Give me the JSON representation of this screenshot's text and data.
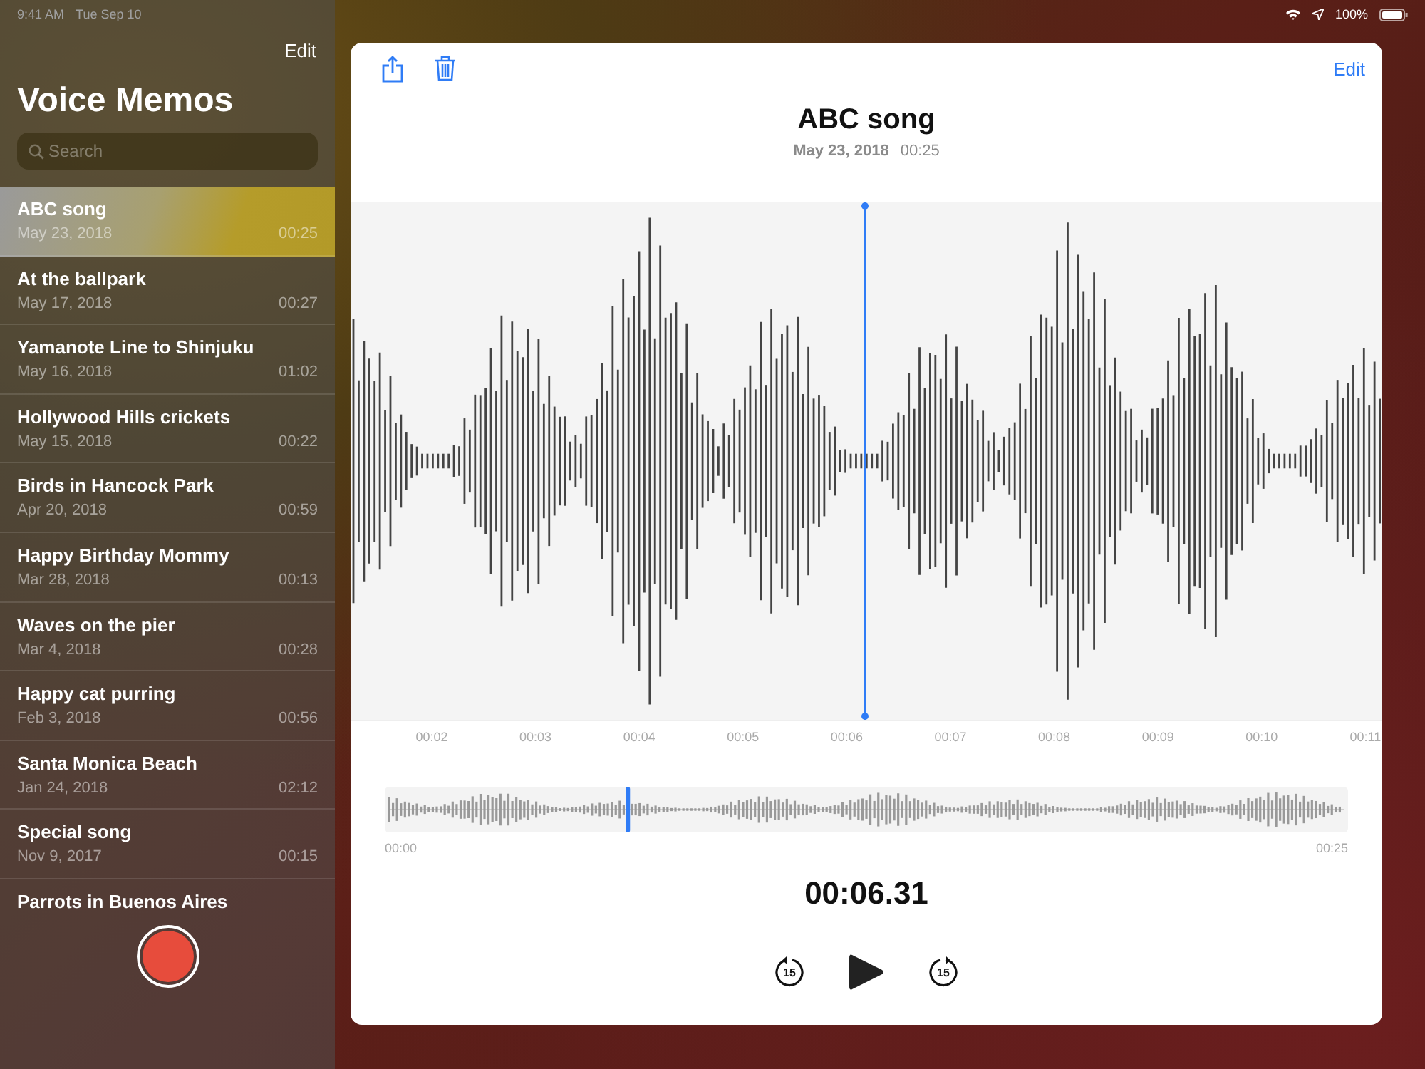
{
  "status_bar": {
    "time": "9:41 AM",
    "date": "Tue Sep 10",
    "battery": "100%"
  },
  "sidebar": {
    "edit": "Edit",
    "title": "Voice Memos",
    "search": {
      "placeholder": "Search"
    },
    "recordings": [
      {
        "name": "ABC song",
        "date": "May 23, 2018",
        "duration": "00:25",
        "selected": true
      },
      {
        "name": "At the ballpark",
        "date": "May 17, 2018",
        "duration": "00:27",
        "selected": false
      },
      {
        "name": "Yamanote Line to Shinjuku",
        "date": "May 16, 2018",
        "duration": "01:02",
        "selected": false
      },
      {
        "name": "Hollywood Hills crickets",
        "date": "May 15, 2018",
        "duration": "00:22",
        "selected": false
      },
      {
        "name": "Birds in Hancock Park",
        "date": "Apr 20, 2018",
        "duration": "00:59",
        "selected": false
      },
      {
        "name": "Happy Birthday Mommy",
        "date": "Mar 28, 2018",
        "duration": "00:13",
        "selected": false
      },
      {
        "name": "Waves on the pier",
        "date": "Mar 4, 2018",
        "duration": "00:28",
        "selected": false
      },
      {
        "name": "Happy cat purring",
        "date": "Feb 3, 2018",
        "duration": "00:56",
        "selected": false
      },
      {
        "name": "Santa Monica Beach",
        "date": "Jan 24, 2018",
        "duration": "02:12",
        "selected": false
      },
      {
        "name": "Special song",
        "date": "Nov 9, 2017",
        "duration": "00:15",
        "selected": false
      },
      {
        "name": "Parrots in Buenos Aires"
      }
    ]
  },
  "detail": {
    "edit": "Edit",
    "title": "ABC song",
    "date": "May 23, 2018",
    "duration": "00:25",
    "time_ticks": [
      "00:02",
      "00:03",
      "00:04",
      "00:05",
      "00:06",
      "00:07",
      "00:08",
      "00:09",
      "00:10",
      "00:11"
    ],
    "overview": {
      "start": "00:00",
      "end": "00:25",
      "level": 0.2524
    },
    "current_time": "00:06.31",
    "skip_back": "15",
    "skip_forward": "15"
  }
}
